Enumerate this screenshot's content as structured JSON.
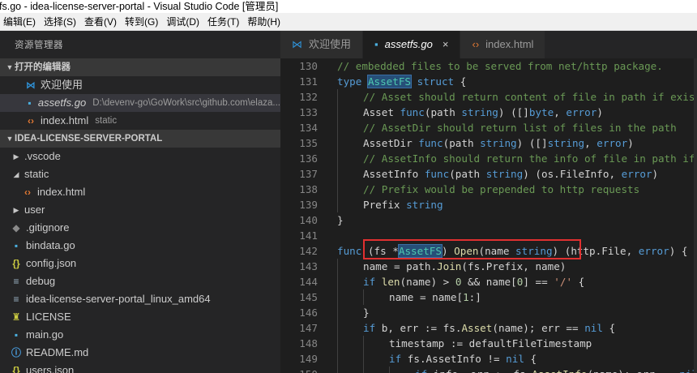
{
  "window": {
    "title": "fs.go - idea-license-server-portal - Visual Studio Code [管理员]"
  },
  "menu": [
    "编辑(E)",
    "选择(S)",
    "查看(V)",
    "转到(G)",
    "调试(D)",
    "任务(T)",
    "帮助(H)"
  ],
  "sidebar": {
    "title": "资源管理器",
    "open_editors_header": "打开的编辑器",
    "open_editors": [
      {
        "label": "欢迎使用",
        "icon": "vscode-icon",
        "desc": ""
      },
      {
        "label": "assetfs.go",
        "icon": "go-file-icon",
        "desc": "D:\\devenv-go\\GoWork\\src\\github.com\\elaza..."
      },
      {
        "label": "index.html",
        "icon": "html-file-icon",
        "desc": "static"
      }
    ],
    "project_header": "IDEA-LICENSE-SERVER-PORTAL",
    "tree": [
      {
        "label": ".vscode",
        "icon": "chevron-right-icon",
        "kind": "folder"
      },
      {
        "label": "static",
        "icon": "chevron-down-icon",
        "kind": "folder-open"
      },
      {
        "label": "index.html",
        "icon": "html-file-icon",
        "kind": "file"
      },
      {
        "label": "user",
        "icon": "chevron-right-icon",
        "kind": "folder"
      },
      {
        "label": ".gitignore",
        "icon": "git-file-icon",
        "kind": "file"
      },
      {
        "label": "bindata.go",
        "icon": "go-file-icon",
        "kind": "file"
      },
      {
        "label": "config.json",
        "icon": "json-file-icon",
        "kind": "file"
      },
      {
        "label": "debug",
        "icon": "binary-file-icon",
        "kind": "file"
      },
      {
        "label": "idea-license-server-portal_linux_amd64",
        "icon": "binary-file-icon",
        "kind": "file"
      },
      {
        "label": "LICENSE",
        "icon": "license-file-icon",
        "kind": "file"
      },
      {
        "label": "main.go",
        "icon": "go-file-icon",
        "kind": "file"
      },
      {
        "label": "README.md",
        "icon": "info-file-icon",
        "kind": "file"
      },
      {
        "label": "users.json",
        "icon": "json-file-icon",
        "kind": "file"
      }
    ]
  },
  "tabs": [
    {
      "label": "欢迎使用",
      "icon": "vscode-icon",
      "active": false
    },
    {
      "label": "assetfs.go",
      "icon": "go-file-icon",
      "active": true,
      "close": "×"
    },
    {
      "label": "index.html",
      "icon": "html-file-icon",
      "active": false
    }
  ],
  "editor": {
    "line_numbers": [
      "130",
      "131",
      "132",
      "133",
      "134",
      "135",
      "136",
      "137",
      "138",
      "139",
      "140",
      "141",
      "142",
      "143",
      "144",
      "145",
      "146",
      "147",
      "148",
      "149",
      "150"
    ],
    "lines": [
      "// embedded files to be served from net/http package.",
      "type AssetFS struct {",
      "\t// Asset should return content of file in path if exists",
      "\tAsset func(path string) ([]byte, error)",
      "\t// AssetDir should return list of files in the path",
      "\tAssetDir func(path string) ([]string, error)",
      "\t// AssetInfo should return the info of file in path if exists",
      "\tAssetInfo func(path string) (os.FileInfo, error)",
      "\t// Prefix would be prepended to http requests",
      "\tPrefix string",
      "}",
      "",
      "func (fs *AssetFS) Open(name string) (http.File, error) {",
      "\tname = path.Join(fs.Prefix, name)",
      "\tif len(name) > 0 && name[0] == '/' {",
      "\t\tname = name[1:]",
      "\t}",
      "\tif b, err := fs.Asset(name); err == nil {",
      "\t\ttimestamp := defaultFileTimestamp",
      "\t\tif fs.AssetInfo != nil {",
      "\t\t\tif info, err := fs.AssetInfo(name); err == nil {"
    ]
  },
  "colors": {
    "highlight_box": "#e03030",
    "accent": "#007acc"
  }
}
